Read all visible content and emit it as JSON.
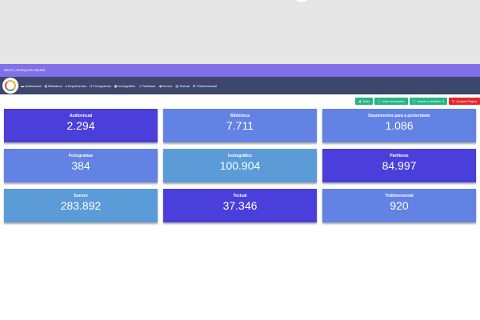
{
  "topbar": {
    "title": "INÍCIO | PESQUISA ONLINE"
  },
  "nav": {
    "items": [
      {
        "icon": "video-camera-icon",
        "glyph": "▬",
        "label": "Audiovisual"
      },
      {
        "icon": "book-icon",
        "glyph": "▤",
        "label": "Biblioteca"
      },
      {
        "icon": "microphone-icon",
        "glyph": "♦",
        "label": "Depoimentos"
      },
      {
        "icon": "headphones-icon",
        "glyph": "Ω",
        "label": "Fonogramas"
      },
      {
        "icon": "image-icon",
        "glyph": "▣",
        "label": "Iconográfico"
      },
      {
        "icon": "music-icon",
        "glyph": "♫",
        "label": "Partituras"
      },
      {
        "icon": "speaker-icon",
        "glyph": "◀",
        "label": "Sonoro"
      },
      {
        "icon": "file-text-icon",
        "glyph": "▤",
        "label": "Textual"
      },
      {
        "icon": "cube-icon",
        "glyph": "⚙",
        "label": "Tridimensional"
      }
    ]
  },
  "toolbar": {
    "back_label": "Voltar",
    "more_info_label": "Mais Informações",
    "bulletin_label": "Acesse os Boletins",
    "refresh_label": "Atualizar Página"
  },
  "cards": [
    {
      "title": "Audiovisual",
      "value": "2.294",
      "color": "#4b3fdb"
    },
    {
      "title": "Biblioteca",
      "value": "7.711",
      "color": "#6282e4"
    },
    {
      "title": "Depoimentos para a posteridade",
      "value": "1.086",
      "color": "#6282e4"
    },
    {
      "title": "Fonogramas",
      "value": "384",
      "color": "#6282e4"
    },
    {
      "title": "Iconográfico",
      "value": "100.904",
      "color": "#5b9bd8"
    },
    {
      "title": "Partituras",
      "value": "84.997",
      "color": "#4b3fdb"
    },
    {
      "title": "Sonoro",
      "value": "283.892",
      "color": "#5b9bd8"
    },
    {
      "title": "Textual",
      "value": "37.346",
      "color": "#4b3fdb"
    },
    {
      "title": "Tridimensional",
      "value": "920",
      "color": "#6282e4"
    }
  ]
}
